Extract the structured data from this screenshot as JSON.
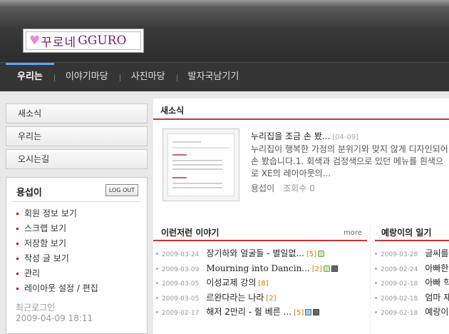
{
  "logo": {
    "heart": "♥",
    "korean": "꾸로네",
    "english": "GGURO"
  },
  "nav": {
    "items": [
      "우리는",
      "이야기마당",
      "사진마당",
      "발자국남기기"
    ]
  },
  "sidebar": {
    "items": [
      "새소식",
      "우리는",
      "오시는길"
    ]
  },
  "login": {
    "user": "용섭이",
    "logout_label": "LOG OUT",
    "menu": [
      "회원 정보 보기",
      "스크랩 보기",
      "저장함 보기",
      "작성 글 보기",
      "관리",
      "레이아웃 설정 / 편집"
    ],
    "last_login_label": "최근로그인",
    "last_login_time": "2009-04-09 18:11"
  },
  "news": {
    "section_title": "새소식",
    "title": "누리집을 조금 손 봤...",
    "date": "[04-09]",
    "body": "누리집이 행복한 가정의 분위기와 맞지 않게 디자인되어 손 봤습니다.1. 회색과 검정색으로 있던 메뉴를 흰색으로 XE의 레이아웃의...",
    "author": "용섭이",
    "views_label": "조회수",
    "views": "0"
  },
  "board1": {
    "title": "이런저런 이야기",
    "more": "more",
    "posts": [
      {
        "date": "2009-03-24",
        "title": "장기하와 얼굴들 - 별일없...",
        "count": "[5]",
        "serif": false,
        "icons": [
          "new"
        ]
      },
      {
        "date": "2009-03-09",
        "title": "Mourning into Dancin...",
        "count": "[2]",
        "serif": true,
        "icons": [
          "new",
          "file"
        ]
      },
      {
        "date": "2009-03-05",
        "title": "이성교제 강의",
        "count": "[8]",
        "serif": false,
        "icons": []
      },
      {
        "date": "2009-03-05",
        "title": "르완다라는 나라",
        "count": "[2]",
        "serif": false,
        "icons": []
      },
      {
        "date": "2009-02-17",
        "title": "해저 2만리 - 쥘 베른 ...",
        "count": "[5]",
        "serif": false,
        "icons": [
          "img",
          "file"
        ]
      }
    ]
  },
  "board2": {
    "title": "예랑이의 일기",
    "posts": [
      {
        "date": "2009-03-28",
        "title": "글씨를"
      },
      {
        "date": "2009-02-24",
        "title": "아빠한테"
      },
      {
        "date": "2009-02-18",
        "title": "아빠 학"
      },
      {
        "date": "2009-02-18",
        "title": "엄마 재"
      },
      {
        "date": "2009-02-18",
        "title": "예랑이"
      }
    ]
  },
  "colors": {
    "accent_red": "#cc3333",
    "nav_active": "#5aa7ff",
    "count_orange": "#e07b00"
  }
}
